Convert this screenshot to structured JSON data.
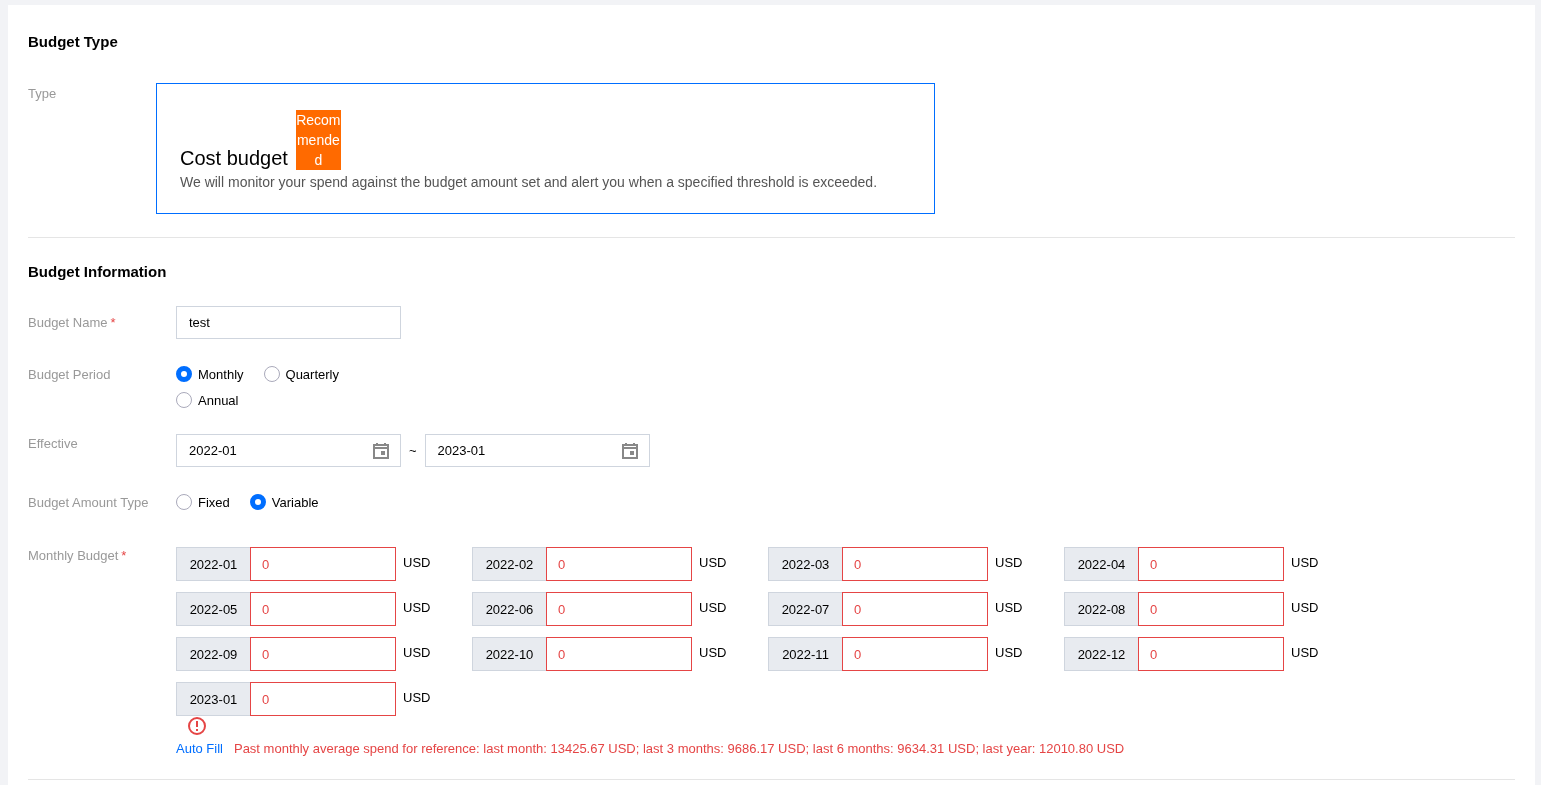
{
  "sections": [
    {
      "title": "Budget Type",
      "rows": [
        {
          "kind": "type_card",
          "label": "Type",
          "card": {
            "title": "Cost budget",
            "badge": "Recommended",
            "description": "We will monitor your spend against the budget amount set and alert you when a specified threshold is exceeded.",
            "selected": true
          }
        }
      ]
    },
    {
      "title": "Budget Information",
      "rows": [
        {
          "kind": "text",
          "label": "Budget Name",
          "required_mark": "*",
          "value": "test"
        },
        {
          "kind": "radio",
          "label": "Budget Period",
          "options": [
            {
              "label": "Monthly",
              "selected": true
            },
            {
              "label": "Quarterly",
              "selected": false
            },
            {
              "label": "Annual",
              "selected": false
            }
          ]
        },
        {
          "kind": "daterange",
          "label": "Effective",
          "start": "2022-01",
          "separator": "~",
          "end": "2023-01"
        },
        {
          "kind": "radio",
          "label": "Budget Amount Type",
          "options": [
            {
              "label": "Fixed",
              "selected": false
            },
            {
              "label": "Variable",
              "selected": true
            }
          ]
        },
        {
          "kind": "monthly",
          "label": "Monthly Budget",
          "required_mark": "*",
          "auto_fill": "Auto Fill",
          "reference": "Past monthly average spend for reference: last month: 13425.67 USD; last 3 months: 9686.17 USD; last 6 months: 9634.31 USD; last year: 12010.80 USD",
          "months": [
            {
              "month": "2022-01",
              "value": "0",
              "unit": "USD",
              "invalid": true
            },
            {
              "month": "2022-02",
              "value": "0",
              "unit": "USD",
              "invalid": true
            },
            {
              "month": "2022-03",
              "value": "0",
              "unit": "USD",
              "invalid": true
            },
            {
              "month": "2022-04",
              "value": "0",
              "unit": "USD",
              "invalid": true
            },
            {
              "month": "2022-05",
              "value": "0",
              "unit": "USD",
              "invalid": true
            },
            {
              "month": "2022-06",
              "value": "0",
              "unit": "USD",
              "invalid": true
            },
            {
              "month": "2022-07",
              "value": "0",
              "unit": "USD",
              "invalid": true
            },
            {
              "month": "2022-08",
              "value": "0",
              "unit": "USD",
              "invalid": true
            },
            {
              "month": "2022-09",
              "value": "0",
              "unit": "USD",
              "invalid": true
            },
            {
              "month": "2022-10",
              "value": "0",
              "unit": "USD",
              "invalid": true
            },
            {
              "month": "2022-11",
              "value": "0",
              "unit": "USD",
              "invalid": true
            },
            {
              "month": "2022-12",
              "value": "0",
              "unit": "USD",
              "invalid": true
            },
            {
              "month": "2023-01",
              "value": "0",
              "unit": "USD",
              "invalid": true
            }
          ]
        }
      ]
    }
  ]
}
